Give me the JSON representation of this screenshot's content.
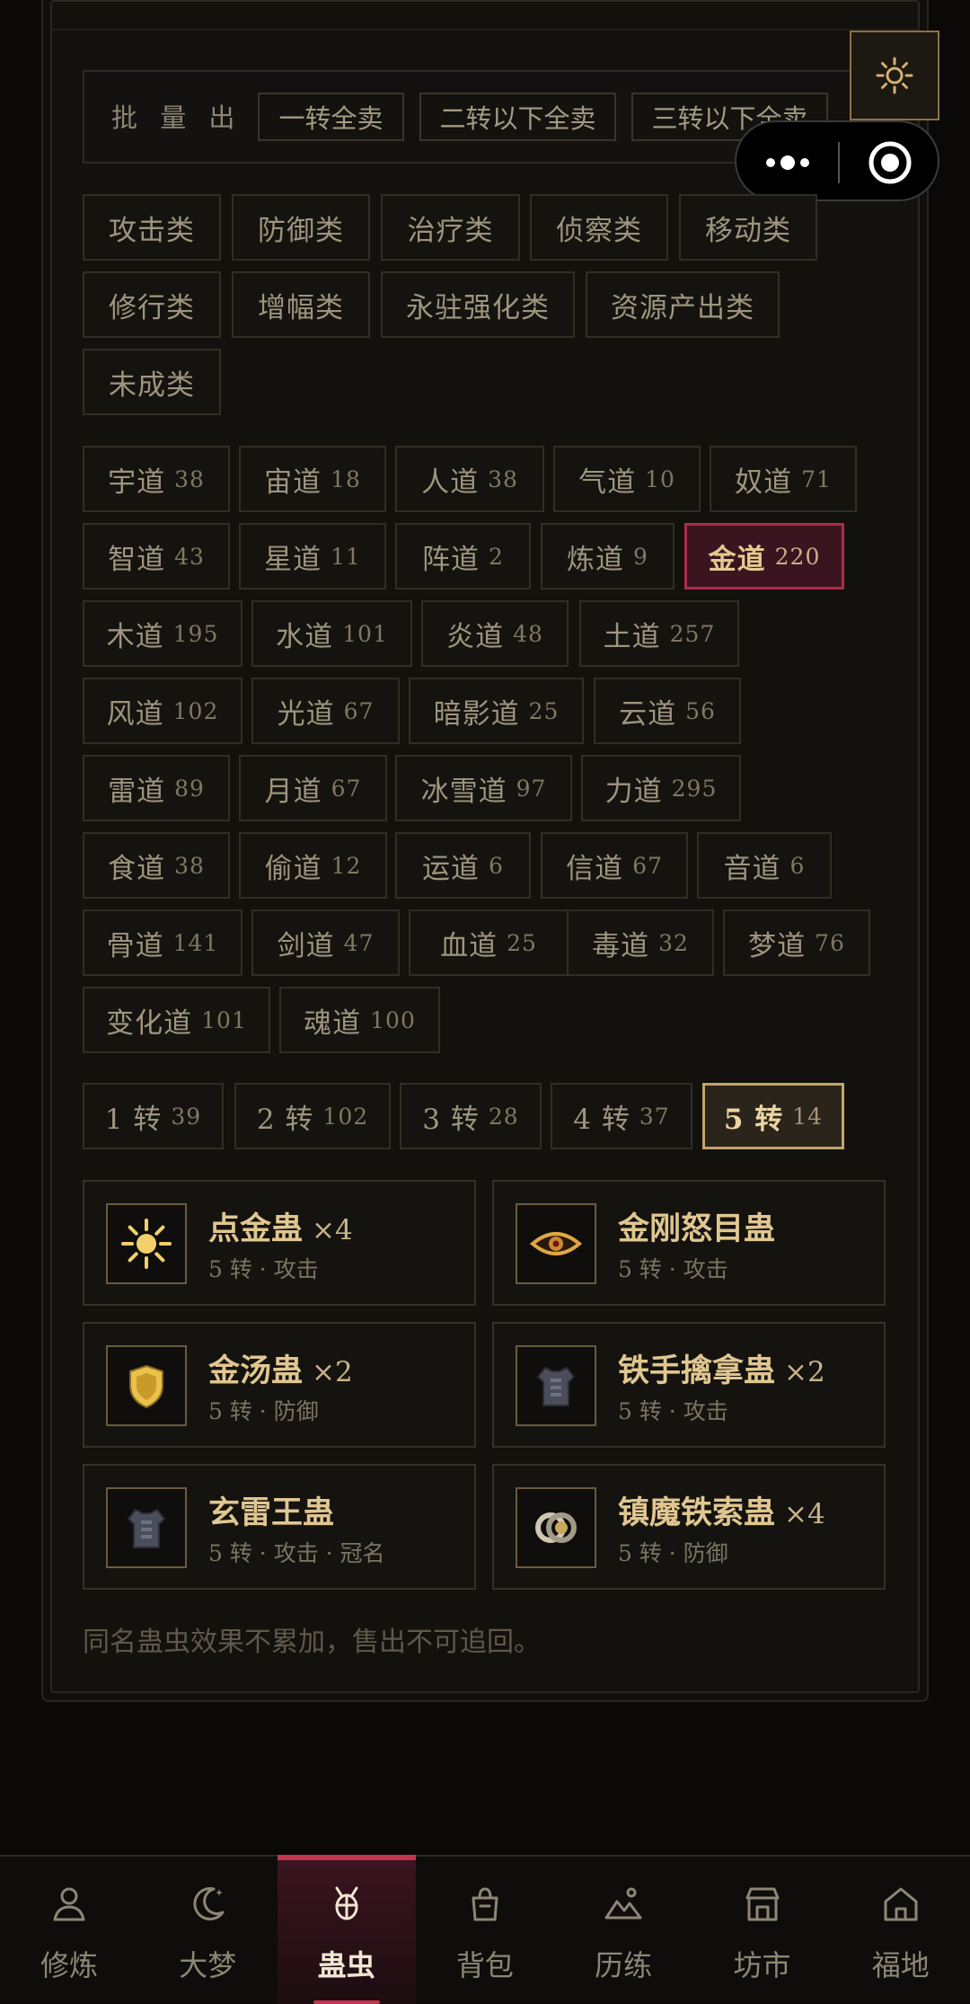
{
  "batch_sell": {
    "label": "批 量 出 售",
    "buttons": [
      "一转全卖",
      "二转以下全卖",
      "三转以下全卖"
    ]
  },
  "categories": [
    "攻击类",
    "防御类",
    "治疗类",
    "侦察类",
    "移动类",
    "修行类",
    "增幅类",
    "永驻强化类",
    "资源产出类",
    "未成类"
  ],
  "paths": [
    {
      "name": "宇道",
      "count": "38"
    },
    {
      "name": "宙道",
      "count": "18"
    },
    {
      "name": "人道",
      "count": "38"
    },
    {
      "name": "气道",
      "count": "10"
    },
    {
      "name": "奴道",
      "count": "71"
    },
    {
      "name": "智道",
      "count": "43"
    },
    {
      "name": "星道",
      "count": "11"
    },
    {
      "name": "阵道",
      "count": "2"
    },
    {
      "name": "炼道",
      "count": "9"
    },
    {
      "name": "金道",
      "count": "220"
    },
    {
      "name": "木道",
      "count": "195"
    },
    {
      "name": "水道",
      "count": "101"
    },
    {
      "name": "炎道",
      "count": "48"
    },
    {
      "name": "土道",
      "count": "257"
    },
    {
      "name": "风道",
      "count": "102"
    },
    {
      "name": "光道",
      "count": "67"
    },
    {
      "name": "暗影道",
      "count": "25"
    },
    {
      "name": "云道",
      "count": "56"
    },
    {
      "name": "雷道",
      "count": "89"
    },
    {
      "name": "月道",
      "count": "67"
    },
    {
      "name": "冰雪道",
      "count": "97"
    },
    {
      "name": "力道",
      "count": "295"
    },
    {
      "name": "食道",
      "count": "38"
    },
    {
      "name": "偷道",
      "count": "12"
    },
    {
      "name": "运道",
      "count": "6"
    },
    {
      "name": "信道",
      "count": "67"
    },
    {
      "name": "音道",
      "count": "6"
    },
    {
      "name": "骨道",
      "count": "141"
    },
    {
      "name": "剑道",
      "count": "47"
    },
    {
      "name": "血道",
      "count": "25"
    },
    {
      "name": "毒道",
      "count": "32"
    },
    {
      "name": "梦道",
      "count": "76"
    },
    {
      "name": "变化道",
      "count": "101"
    },
    {
      "name": "魂道",
      "count": "100"
    }
  ],
  "selected_path": "金道",
  "ranks": [
    {
      "name": "1 转",
      "count": "39"
    },
    {
      "name": "2 转",
      "count": "102"
    },
    {
      "name": "3 转",
      "count": "28"
    },
    {
      "name": "4 转",
      "count": "37"
    },
    {
      "name": "5 转",
      "count": "14"
    }
  ],
  "selected_rank": "5 转",
  "gu_list": [
    {
      "name": "点金蛊",
      "qty": "×4",
      "sub": "5 转 · 攻击",
      "icon": "sun-icon"
    },
    {
      "name": "金刚怒目蛊",
      "qty": "",
      "sub": "5 转 · 攻击",
      "icon": "eye-icon"
    },
    {
      "name": "金汤蛊",
      "qty": "×2",
      "sub": "5 转 · 防御",
      "icon": "shield-icon"
    },
    {
      "name": "铁手擒拿蛊",
      "qty": "×2",
      "sub": "5 转 · 攻击",
      "icon": "armor-icon"
    },
    {
      "name": "玄雷王蛊",
      "qty": "",
      "sub": "5 转 · 攻击 · 冠名",
      "icon": "armor-icon"
    },
    {
      "name": "镇魔铁索蛊",
      "qty": "×4",
      "sub": "5 转 · 防御",
      "icon": "ring-icon"
    }
  ],
  "note": "同名蛊虫效果不累加，售出不可追回。",
  "nav": [
    {
      "label": "修炼",
      "icon": "person-icon"
    },
    {
      "label": "大梦",
      "icon": "moon-icon"
    },
    {
      "label": "蛊虫",
      "icon": "bug-icon"
    },
    {
      "label": "背包",
      "icon": "bag-icon"
    },
    {
      "label": "历练",
      "icon": "mountain-icon"
    },
    {
      "label": "坊市",
      "icon": "shop-icon"
    },
    {
      "label": "福地",
      "icon": "home-icon"
    }
  ],
  "nav_active": "蛊虫",
  "colors": {
    "accent_red": "#c4344f",
    "accent_gold": "#c4a46a",
    "text_gold": "#e0c690"
  }
}
